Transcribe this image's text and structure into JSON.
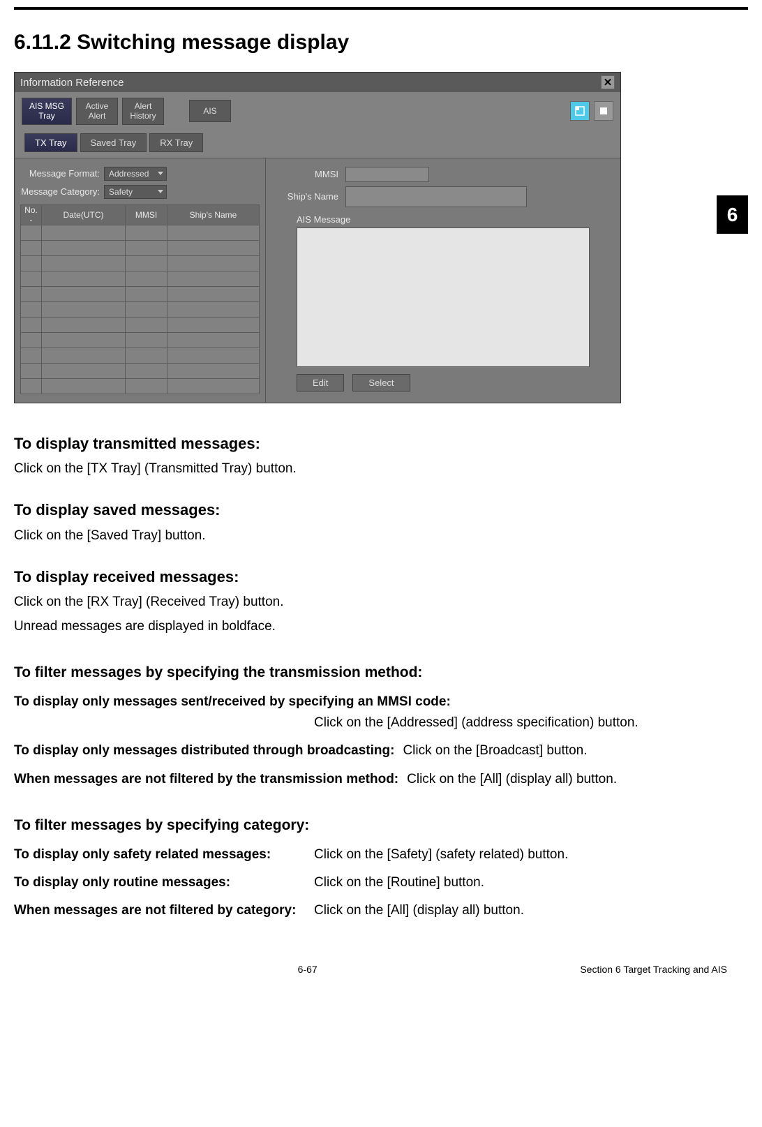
{
  "heading": "6.11.2 Switching message display",
  "side_tab": "6",
  "window": {
    "title": "Information Reference",
    "top_tabs": {
      "ais_msg_tray_l1": "AIS MSG",
      "ais_msg_tray_l2": "Tray",
      "active_alert_l1": "Active",
      "active_alert_l2": "Alert",
      "alert_history_l1": "Alert",
      "alert_history_l2": "History",
      "ais": "AIS"
    },
    "sub_tabs": {
      "tx": "TX Tray",
      "saved": "Saved Tray",
      "rx": "RX Tray"
    },
    "filters": {
      "format_label": "Message Format:",
      "format_value": "Addressed",
      "category_label": "Message Category:",
      "category_value": "Safety"
    },
    "table_headers": {
      "no": "No. -",
      "date": "Date(UTC)",
      "mmsi": "MMSI",
      "name": "Ship's Name"
    },
    "right": {
      "mmsi_label": "MMSI",
      "name_label": "Ship's Name",
      "ais_msg_label": "AIS Message",
      "edit_btn": "Edit",
      "select_btn": "Select"
    }
  },
  "body": {
    "h_tx": "To display transmitted messages:",
    "p_tx": "Click on the [TX Tray] (Transmitted Tray) button.",
    "h_saved": "To display saved messages:",
    "p_saved": "Click on the [Saved Tray] button.",
    "h_rx": "To display received messages:",
    "p_rx1": "Click on the [RX Tray] (Received Tray) button.",
    "p_rx2": "Unread messages are displayed in boldface.",
    "h_filter_tx": "To filter messages by specifying the transmission method:",
    "f1_label": "To display only messages sent/received by specifying an MMSI code:",
    "f1_val": "Click on the [Addressed] (address specification) button.",
    "f2_label": "To display only messages distributed through broadcasting:",
    "f2_val": "Click on the [Broadcast] button.",
    "f3_label": "When messages are not filtered by the transmission method:",
    "f3_val": "Click on the [All] (display all) button.",
    "h_filter_cat": "To filter messages by specifying category:",
    "c1_label": "To display only safety related messages:",
    "c1_val": "Click on the [Safety] (safety related) button.",
    "c2_label": "To display only routine messages:",
    "c2_val": "Click on the [Routine] button.",
    "c3_label": "When messages are not filtered by category:",
    "c3_val": "Click on the [All] (display all) button."
  },
  "footer": {
    "page": "6-67",
    "section": "Section 6  Target Tracking and AIS"
  }
}
